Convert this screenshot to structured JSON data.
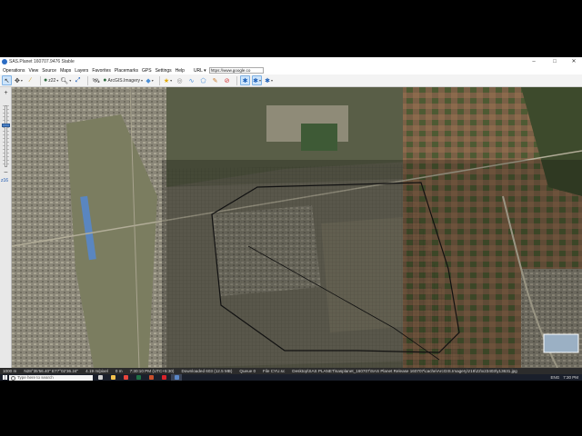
{
  "window": {
    "title": "SAS.Planet 160707.9476 Stable",
    "controls": {
      "minimize": "–",
      "maximize": "□",
      "close": "✕"
    }
  },
  "menu": {
    "items": [
      "Operations",
      "View",
      "Source",
      "Maps",
      "Layers",
      "Favorites",
      "Placemarks",
      "GPS",
      "Settings",
      "Help"
    ],
    "url_label": "URL ▾",
    "url_value": "https://www.google.co"
  },
  "toolbar": {
    "zoom_label": "z22",
    "map_source_label": "ArcGIS.Imagery",
    "icons": [
      "cursor-icon",
      "pan-icon",
      "ruler-icon",
      "globe-icon",
      "zoom-icon",
      "fullscreen-icon",
      "satellite-icon",
      "star-icon",
      "marker-icon",
      "path-icon",
      "polygon-icon",
      "delete-icon",
      "gps-icon",
      "gps-track-icon",
      "gps-center-icon"
    ]
  },
  "zoombar": {
    "plus": "+",
    "minus": "–",
    "level_text": "z16",
    "level_fraction": 0.68
  },
  "status": {
    "scale": "1000 m",
    "coordinates": "N28°35'56.40\" E77°02'36.24\"",
    "resolution": "4.19 m/pixel",
    "distance": "0 m",
    "time": "7:30:10 PM (UTC+5:30)",
    "downloaded": "Downloaded 603 (12.5 MB)",
    "queue": "Queue 0",
    "file_label": "File CYU.sc",
    "file_path": "Desktop\\SAS PLANET\\sasplanet_160707\\SAS Planet Release 160707\\cache\\ArcGIS.Imagery\\z16\\22\\x23403\\y13631.jpg"
  },
  "taskbar": {
    "search_placeholder": "Type here to search",
    "apps": [
      "task-view",
      "file-explorer",
      "chrome",
      "excel",
      "powerpoint",
      "acrobat",
      "sas-planet"
    ],
    "app_colors": [
      "#cfcfcf",
      "#f2c14e",
      "#e8453c",
      "#1e7145",
      "#c94f2c",
      "#d8232a",
      "#5b87c7"
    ],
    "language": "ENG",
    "clock_time": "7:30 PM",
    "clock_date": "5/25/2019"
  },
  "colors": {
    "menu_bg": "#ffffff",
    "toolbar_bg": "#f3f3f3",
    "status_bg": "#2c2c2c",
    "taskbar_bg": "#1a1f2b",
    "selection_overlay": "#000000"
  }
}
